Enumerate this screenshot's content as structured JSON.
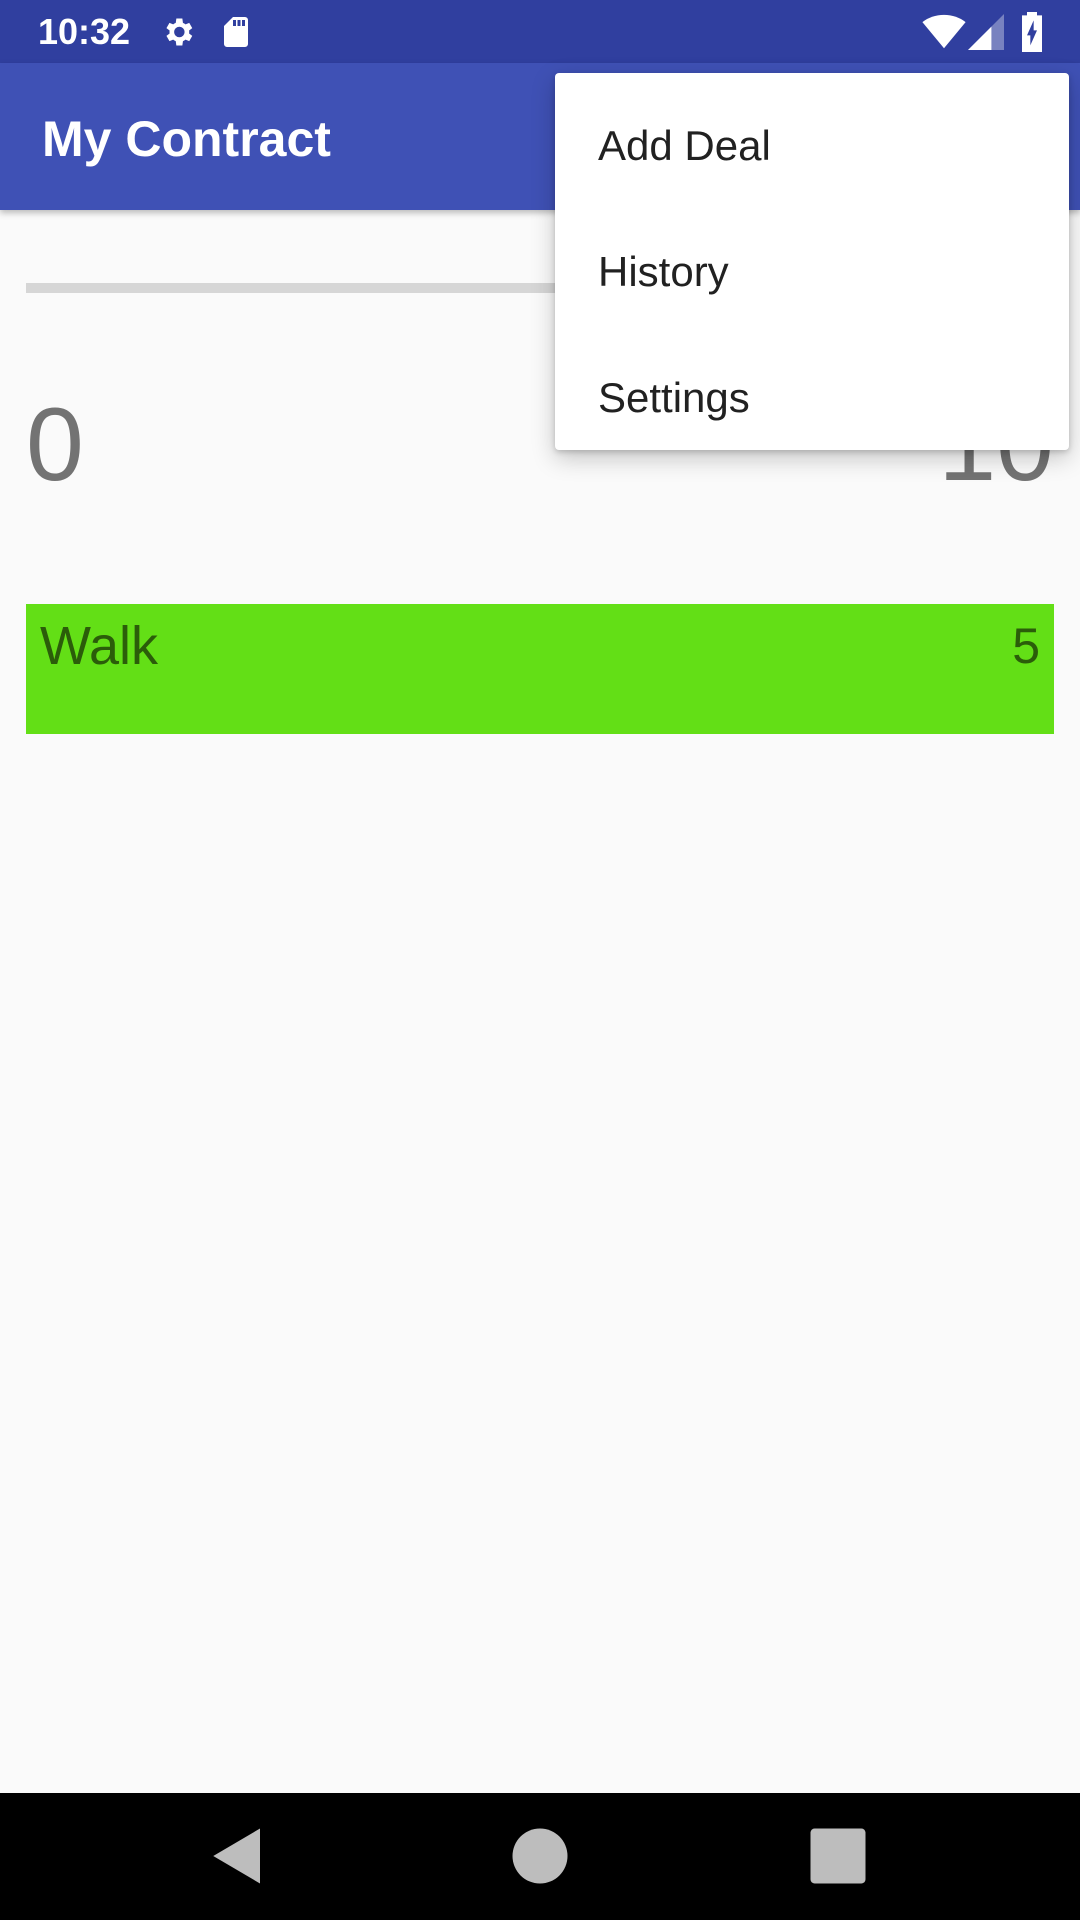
{
  "status_bar": {
    "time": "10:32",
    "icons": [
      "settings-icon",
      "sd-card-icon",
      "wifi-icon",
      "cell-signal-icon",
      "battery-charging-icon"
    ]
  },
  "app_bar": {
    "title": "My Contract"
  },
  "progress": {
    "min_label": "0",
    "max_label": "10",
    "value": 0,
    "max": 10
  },
  "deals": [
    {
      "name": "Walk",
      "count": "5",
      "color": "#63df16"
    }
  ],
  "menu": {
    "items": [
      {
        "label": "Add Deal"
      },
      {
        "label": "History"
      },
      {
        "label": "Settings"
      }
    ]
  },
  "nav_bar": {
    "buttons": [
      "back-icon",
      "home-icon",
      "recents-icon"
    ]
  },
  "colors": {
    "primary": "#3f51b5",
    "primary_dark": "#303f9f",
    "deal_green": "#63df16"
  }
}
